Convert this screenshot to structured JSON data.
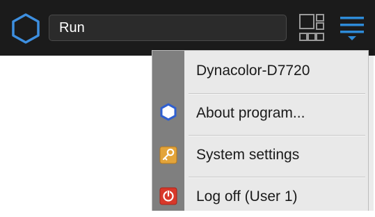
{
  "topbar": {
    "search_value": "Run",
    "icons": {
      "logo": "hexagon-logo-icon",
      "layout": "layout-grid-icon",
      "menu": "hamburger-menu-icon"
    },
    "colors": {
      "background": "#1b1b1b",
      "accent_blue": "#2e8bd8"
    }
  },
  "menu": {
    "items": [
      {
        "label": "Dynacolor-D7720",
        "icon": ""
      },
      {
        "label": "About program...",
        "icon": "hexagon-icon"
      },
      {
        "label": "System settings",
        "icon": "key-icon"
      },
      {
        "label": "Log off (User 1)",
        "icon": "power-icon"
      }
    ]
  }
}
